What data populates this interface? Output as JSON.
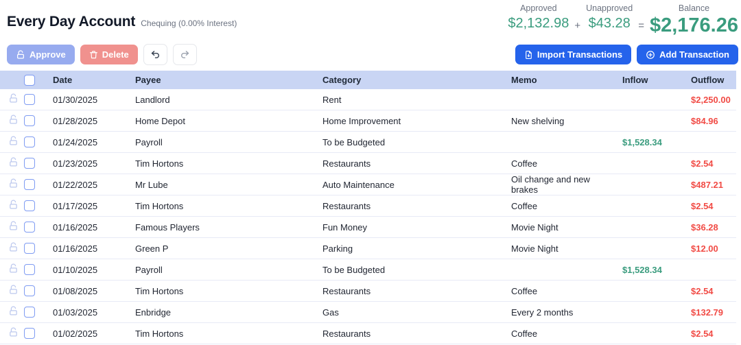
{
  "header": {
    "title": "Every Day Account",
    "subtitle": "Chequing (0.00% Interest)",
    "summary": {
      "approved_label": "Approved",
      "approved_value": "$2,132.98",
      "plus_op": "+",
      "unapproved_label": "Unapproved",
      "unapproved_value": "$43.28",
      "equals_op": "=",
      "balance_label": "Balance",
      "balance_value": "$2,176.26"
    }
  },
  "toolbar": {
    "approve_label": "Approve",
    "delete_label": "Delete",
    "import_label": "Import Transactions",
    "add_label": "Add Transaction"
  },
  "table": {
    "columns": [
      "Date",
      "Payee",
      "Category",
      "Memo",
      "Inflow",
      "Outflow"
    ],
    "rows": [
      {
        "date": "01/30/2025",
        "payee": "Landlord",
        "category": "Rent",
        "memo": "",
        "inflow": "",
        "outflow": "$2,250.00"
      },
      {
        "date": "01/28/2025",
        "payee": "Home Depot",
        "category": "Home Improvement",
        "memo": "New shelving",
        "inflow": "",
        "outflow": "$84.96"
      },
      {
        "date": "01/24/2025",
        "payee": "Payroll",
        "category": "To be Budgeted",
        "memo": "",
        "inflow": "$1,528.34",
        "outflow": ""
      },
      {
        "date": "01/23/2025",
        "payee": "Tim Hortons",
        "category": "Restaurants",
        "memo": "Coffee",
        "inflow": "",
        "outflow": "$2.54"
      },
      {
        "date": "01/22/2025",
        "payee": "Mr Lube",
        "category": "Auto Maintenance",
        "memo": "Oil change and new brakes",
        "inflow": "",
        "outflow": "$487.21"
      },
      {
        "date": "01/17/2025",
        "payee": "Tim Hortons",
        "category": "Restaurants",
        "memo": "Coffee",
        "inflow": "",
        "outflow": "$2.54"
      },
      {
        "date": "01/16/2025",
        "payee": "Famous Players",
        "category": "Fun Money",
        "memo": "Movie Night",
        "inflow": "",
        "outflow": "$36.28"
      },
      {
        "date": "01/16/2025",
        "payee": "Green P",
        "category": "Parking",
        "memo": "Movie Night",
        "inflow": "",
        "outflow": "$12.00"
      },
      {
        "date": "01/10/2025",
        "payee": "Payroll",
        "category": "To be Budgeted",
        "memo": "",
        "inflow": "$1,528.34",
        "outflow": ""
      },
      {
        "date": "01/08/2025",
        "payee": "Tim Hortons",
        "category": "Restaurants",
        "memo": "Coffee",
        "inflow": "",
        "outflow": "$2.54"
      },
      {
        "date": "01/03/2025",
        "payee": "Enbridge",
        "category": "Gas",
        "memo": "Every 2 months",
        "inflow": "",
        "outflow": "$132.79"
      },
      {
        "date": "01/02/2025",
        "payee": "Tim Hortons",
        "category": "Restaurants",
        "memo": "Coffee",
        "inflow": "",
        "outflow": "$2.54"
      }
    ]
  },
  "colors": {
    "accent_green": "#3a9c7e",
    "accent_red": "#f14b45",
    "primary_blue": "#2563eb",
    "approve_bg": "#97abef",
    "delete_bg": "#f0918e",
    "table_header_bg": "#c9d5f4",
    "checkbox_border": "#7e9bf2",
    "lock_icon": "#bcc8ee"
  }
}
